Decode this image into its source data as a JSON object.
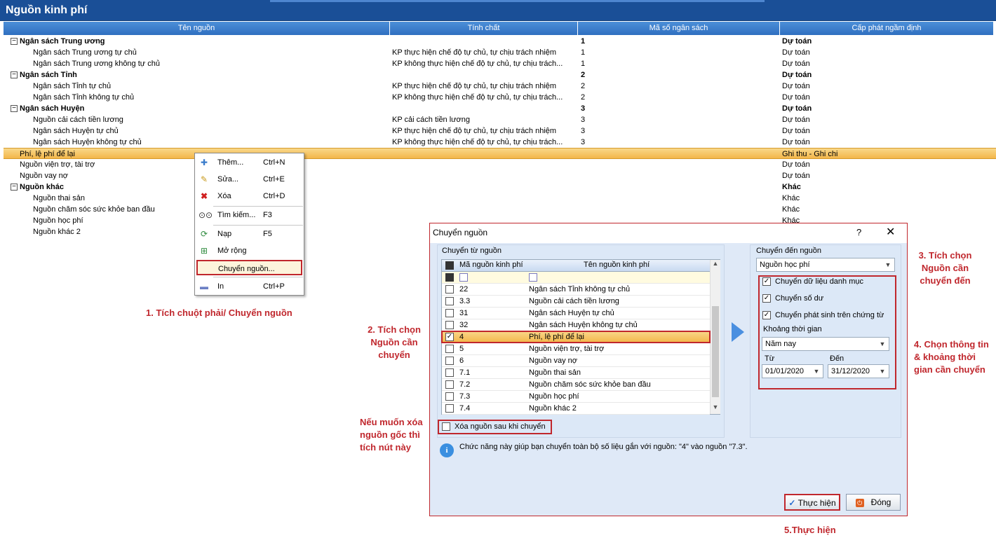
{
  "window": {
    "title": "Nguồn kinh phí"
  },
  "columns": [
    "Tên nguồn",
    "Tính chất",
    "Mã số ngân sách",
    "Cấp phát ngầm định"
  ],
  "rows": [
    {
      "name": "Ngân sách Trung ương",
      "nature": "",
      "code": "1",
      "alloc": "Dự toán",
      "bold": true,
      "toggle": "−"
    },
    {
      "name": "Ngân sách Trung ương tự chủ",
      "nature": "KP thực hiện chế độ tự chủ, tự chịu trách nhiệm",
      "code": "1",
      "alloc": "Dự toán"
    },
    {
      "name": "Ngân sách Trung ương không tự chủ",
      "nature": "KP không thực hiện chế độ tự chủ, tự chịu trách...",
      "code": "1",
      "alloc": "Dự toán"
    },
    {
      "name": "Ngân sách Tỉnh",
      "nature": "",
      "code": "2",
      "alloc": "Dự toán",
      "bold": true,
      "toggle": "−"
    },
    {
      "name": "Ngân sách Tỉnh tự chủ",
      "nature": "KP thực hiện chế độ tự chủ, tự chịu trách nhiệm",
      "code": "2",
      "alloc": "Dự toán"
    },
    {
      "name": "Ngân sách Tỉnh không tự chủ",
      "nature": "KP không thực hiện chế độ tự chủ, tự chịu trách...",
      "code": "2",
      "alloc": "Dự toán"
    },
    {
      "name": "Ngân sách Huyện",
      "nature": "",
      "code": "3",
      "alloc": "Dự toán",
      "bold": true,
      "toggle": "−"
    },
    {
      "name": "Nguồn cải cách tiền lương",
      "nature": "KP cải cách tiền lương",
      "code": "3",
      "alloc": "Dự toán"
    },
    {
      "name": "Ngân sách Huyện tự chủ",
      "nature": "KP thực hiện chế độ tự chủ, tự chịu trách nhiệm",
      "code": "3",
      "alloc": "Dự toán"
    },
    {
      "name": "Ngân sách Huyện không tự chủ",
      "nature": "KP không thực hiện chế độ tự chủ, tự chịu trách...",
      "code": "3",
      "alloc": "Dự toán"
    },
    {
      "name": "Phí, lệ phí để lại",
      "nature": "",
      "code": "",
      "alloc": "Ghi thu - Ghi chi",
      "selected": true
    },
    {
      "name": "Nguồn viện trợ, tài trợ",
      "nature": "",
      "code": "",
      "alloc": "Dự toán"
    },
    {
      "name": "Nguồn vay nợ",
      "nature": "",
      "code": "",
      "alloc": "Dự toán"
    },
    {
      "name": "Nguồn khác",
      "nature": "",
      "code": "",
      "alloc": "Khác",
      "bold": true,
      "toggle": "−"
    },
    {
      "name": "Nguồn thai sản",
      "nature": "",
      "code": "",
      "alloc": "Khác"
    },
    {
      "name": "Nguồn chăm sóc sức khỏe ban đầu",
      "nature": "",
      "code": "",
      "alloc": "Khác"
    },
    {
      "name": "Nguồn học phí",
      "nature": "",
      "code": "",
      "alloc": "Khác"
    },
    {
      "name": "Nguồn khác 2",
      "nature": "",
      "code": "",
      "alloc": ""
    }
  ],
  "menu": [
    {
      "label": "Thêm...",
      "shortcut": "Ctrl+N",
      "icon": "add-icon"
    },
    {
      "label": "Sửa...",
      "shortcut": "Ctrl+E",
      "icon": "edit-icon"
    },
    {
      "label": "Xóa",
      "shortcut": "Ctrl+D",
      "icon": "delete-icon"
    },
    {
      "label": "Tìm kiếm...",
      "shortcut": "F3",
      "icon": "binoculars-icon"
    },
    {
      "label": "Nạp",
      "shortcut": "F5",
      "icon": "refresh-icon"
    },
    {
      "label": "Mở rộng",
      "shortcut": "",
      "icon": "expand-icon"
    },
    {
      "label": "Chuyển nguồn...",
      "shortcut": "",
      "icon": ""
    },
    {
      "label": "In",
      "shortcut": "Ctrl+P",
      "icon": "print-icon"
    }
  ],
  "dialog": {
    "title": "Chuyển nguồn",
    "help": "?",
    "close": "✕",
    "from_label": "Chuyển từ nguồn",
    "grid_headers": [
      "Mã nguồn kinh phí",
      "Tên nguồn kinh phí"
    ],
    "grid_rows": [
      {
        "code": "22",
        "name": "Ngân sách Tỉnh không tự chủ",
        "checked": false
      },
      {
        "code": "3.3",
        "name": "Nguồn cải cách tiền lương",
        "checked": false
      },
      {
        "code": "31",
        "name": "Ngân sách Huyện tự chủ",
        "checked": false
      },
      {
        "code": "32",
        "name": "Ngân sách Huyện không tự chủ",
        "checked": false
      },
      {
        "code": "4",
        "name": "Phí, lệ phí để lại",
        "checked": true
      },
      {
        "code": "5",
        "name": "Nguồn viện trợ, tài trợ",
        "checked": false
      },
      {
        "code": "6",
        "name": "Nguồn vay nợ",
        "checked": false
      },
      {
        "code": "7.1",
        "name": "Nguồn thai sản",
        "checked": false
      },
      {
        "code": "7.2",
        "name": "Nguồn chăm sóc sức khỏe ban đầu",
        "checked": false
      },
      {
        "code": "7.3",
        "name": "Nguồn học phí",
        "checked": false
      },
      {
        "code": "7.4",
        "name": "Nguồn khác 2",
        "checked": false
      }
    ],
    "delete_label": "Xóa nguồn sau khi chuyển",
    "info": "Chức năng này giúp bạn chuyển toàn bộ số liệu gắn với nguồn: \"4\" vào nguồn \"7.3\".",
    "to_label": "Chuyển đến nguồn",
    "to_value": "Nguồn học phí",
    "opt1": "Chuyển dữ liệu danh mục",
    "opt2": "Chuyển số dư",
    "opt3": "Chuyển phát sinh trên chứng từ",
    "period_label": "Khoảng thời gian",
    "period_value": "Năm nay",
    "from_date_label": "Từ",
    "from_date": "01/01/2020",
    "to_date_label": "Đến",
    "to_date": "31/12/2020",
    "execute": "Thực hiện",
    "close_btn": "Đóng"
  },
  "annotations": {
    "a1": "1. Tích chuột phải/ Chuyển nguồn",
    "a2": "2. Tích chọn Nguồn cần chuyển",
    "a3": "3. Tích chọn Nguồn cần chuyển đến",
    "a4": "4. Chọn thông tin & khoảng thời gian cần chuyển",
    "a5": "5.Thực hiện",
    "a6": "Nếu muốn xóa nguồn gốc thì tích nút này"
  },
  "colors": {
    "title_bg": "#1a4f97",
    "header_bg": "#3a7ccb",
    "highlight": "#f3b64a",
    "annotation": "#c0272d"
  }
}
